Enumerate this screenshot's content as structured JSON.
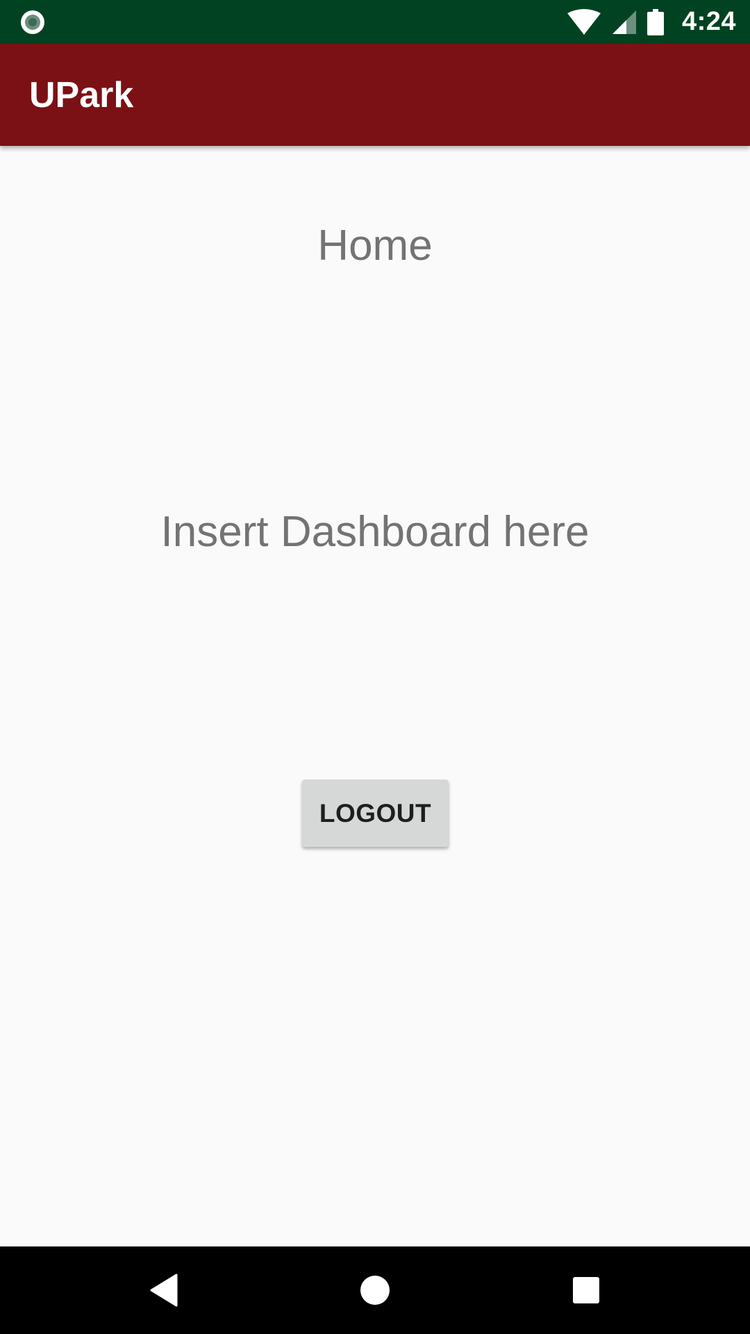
{
  "status_bar": {
    "time": "4:24",
    "left_icon": "recording-dot-icon",
    "icons": [
      "wifi-icon",
      "cell-signal-icon",
      "battery-icon"
    ],
    "background": "#004221"
  },
  "app_bar": {
    "title": "UPark",
    "background": "#7b1114"
  },
  "main": {
    "heading": "Home",
    "placeholder_text": "Insert Dashboard here",
    "logout_label": "LOGOUT"
  },
  "nav_bar": {
    "buttons": [
      "back-icon",
      "home-icon",
      "recents-icon"
    ]
  }
}
